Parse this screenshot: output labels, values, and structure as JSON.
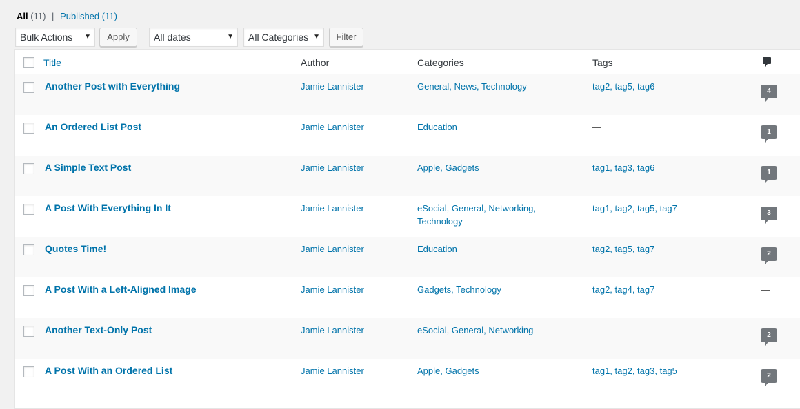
{
  "status": {
    "all_label": "All",
    "all_count": "(11)",
    "separator": "|",
    "published_label": "Published",
    "published_count": "(11)"
  },
  "filters": {
    "bulk_actions": "Bulk Actions",
    "apply_label": "Apply",
    "dates": "All dates",
    "categories": "All Categories",
    "filter_label": "Filter"
  },
  "columns": {
    "title": "Title",
    "author": "Author",
    "categories": "Categories",
    "tags": "Tags",
    "comments_icon": "comment-icon"
  },
  "posts": [
    {
      "title": "Another Post with Everything",
      "author": "Jamie Lannister",
      "categories_line1": "General, News, Technology",
      "categories_line2": "",
      "tags": "tag2, tag5, tag6",
      "comments": "4"
    },
    {
      "title": "An Ordered List Post",
      "author": "Jamie Lannister",
      "categories_line1": "Education",
      "categories_line2": "",
      "tags": "—",
      "comments": "1"
    },
    {
      "title": "A Simple Text Post",
      "author": "Jamie Lannister",
      "categories_line1": "Apple, Gadgets",
      "categories_line2": "",
      "tags": "tag1, tag3, tag6",
      "comments": "1"
    },
    {
      "title": "A Post With Everything In It",
      "author": "Jamie Lannister",
      "categories_line1": "eSocial, General, Networking,",
      "categories_line2": "Technology",
      "tags": "tag1, tag2, tag5, tag7",
      "comments": "3"
    },
    {
      "title": "Quotes Time!",
      "author": "Jamie Lannister",
      "categories_line1": "Education",
      "categories_line2": "",
      "tags": "tag2, tag5, tag7",
      "comments": "2"
    },
    {
      "title": "A Post With a Left-Aligned Image",
      "author": "Jamie Lannister",
      "categories_line1": "Gadgets, Technology",
      "categories_line2": "",
      "tags": "tag2, tag4, tag7",
      "comments": "—"
    },
    {
      "title": "Another Text-Only Post",
      "author": "Jamie Lannister",
      "categories_line1": "eSocial, General, Networking",
      "categories_line2": "",
      "tags": "—",
      "comments": "2"
    },
    {
      "title": "A Post With an Ordered List",
      "author": "Jamie Lannister",
      "categories_line1": "Apple, Gadgets",
      "categories_line2": "",
      "tags": "tag1, tag2, tag3, tag5",
      "comments": "2"
    }
  ]
}
